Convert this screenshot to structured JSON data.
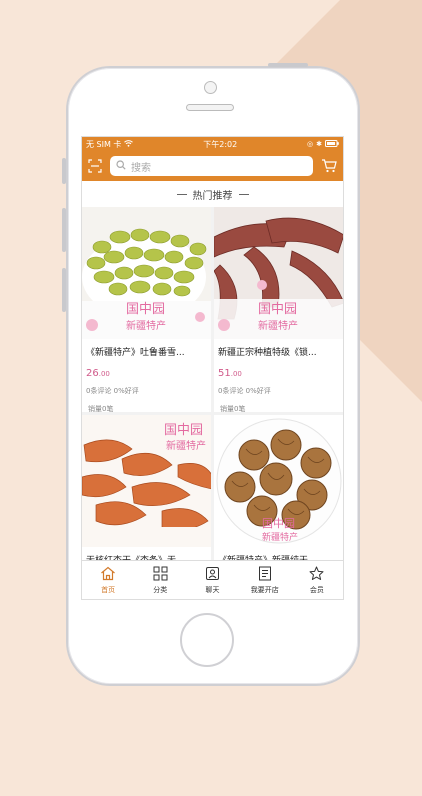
{
  "status_bar": {
    "carrier": "无 SIM 卡",
    "time": "下午2:02"
  },
  "search": {
    "placeholder": "搜索"
  },
  "section": {
    "title": "热门推荐"
  },
  "products": [
    {
      "title": "《新疆特产》吐鲁番雪...",
      "price_main": "26",
      "price_cents": ".00",
      "reviews": "0条评论 0%好评",
      "sales": "销量0笔",
      "brand": "国中园",
      "brand_sub": "新疆特产"
    },
    {
      "title": "新疆正宗种植特级《锁...",
      "price_main": "51",
      "price_cents": ".00",
      "reviews": "0条评论 0%好评",
      "sales": "销量0笔",
      "brand": "国中园",
      "brand_sub": "新疆特产"
    },
    {
      "title": "无核红杏干《杏条》无...",
      "brand": "国中园",
      "brand_sub": "新疆特产"
    },
    {
      "title": "《新疆特产》新疆纯天...",
      "brand": "国中园",
      "brand_sub": "新疆特产"
    }
  ],
  "tabs": [
    {
      "label": "首页",
      "icon": "home-icon"
    },
    {
      "label": "分类",
      "icon": "grid-icon"
    },
    {
      "label": "聊天",
      "icon": "chat-icon"
    },
    {
      "label": "我要开店",
      "icon": "store-icon"
    },
    {
      "label": "会员",
      "icon": "star-icon"
    }
  ],
  "colors": {
    "accent": "#e0862a",
    "price": "#d05a8a",
    "background": "#f8e6d8"
  }
}
